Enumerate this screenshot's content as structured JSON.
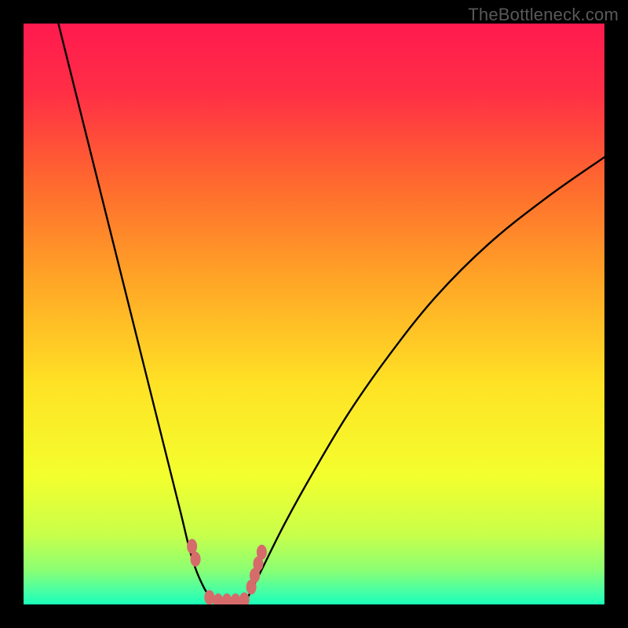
{
  "watermark": "TheBottleneck.com",
  "colors": {
    "background": "#000000",
    "watermark_text": "#595959",
    "curve": "#000000",
    "marker": "#d66b6b"
  },
  "chart_data": {
    "type": "line",
    "title": "",
    "xlabel": "",
    "ylabel": "",
    "xlim": [
      0,
      100
    ],
    "ylim": [
      0,
      100
    ],
    "grid": false,
    "legend": false,
    "background_gradient": {
      "description": "Vertical rainbow gradient: bright red at top through orange and yellow to green at bottom",
      "stops": [
        {
          "pos": 0.0,
          "color": "#ff1a4f"
        },
        {
          "pos": 0.12,
          "color": "#ff2f45"
        },
        {
          "pos": 0.28,
          "color": "#ff6b2e"
        },
        {
          "pos": 0.45,
          "color": "#ffa826"
        },
        {
          "pos": 0.62,
          "color": "#ffe225"
        },
        {
          "pos": 0.78,
          "color": "#f3ff2e"
        },
        {
          "pos": 0.88,
          "color": "#c8ff4a"
        },
        {
          "pos": 0.94,
          "color": "#8cff72"
        },
        {
          "pos": 0.98,
          "color": "#42ffa8"
        },
        {
          "pos": 1.0,
          "color": "#19ffb8"
        }
      ]
    },
    "series": [
      {
        "name": "left-branch",
        "description": "Steep V left arm descending from upper-left to valley near x≈33",
        "x": [
          6,
          9,
          12,
          15,
          18,
          21,
          24,
          27,
          29,
          31,
          33
        ],
        "y": [
          100,
          88,
          76,
          64,
          52,
          40,
          28,
          16,
          8,
          3,
          0
        ]
      },
      {
        "name": "right-branch",
        "description": "Right arm rising from valley near x≈38 with gentler curvature toward upper-right",
        "x": [
          38,
          41,
          45,
          50,
          56,
          63,
          71,
          80,
          90,
          100
        ],
        "y": [
          0,
          6,
          14,
          23,
          33,
          43,
          53,
          62,
          70,
          77
        ]
      },
      {
        "name": "valley-floor",
        "description": "Flat valley bottom between branches at y≈0",
        "x": [
          33,
          34,
          35,
          36,
          37,
          38
        ],
        "y": [
          0,
          0,
          0,
          0,
          0,
          0
        ]
      }
    ],
    "markers": {
      "name": "valley-markers",
      "description": "Salmon-colored oval markers near the valley (pairs on left descent, cluster on right ascent, and along floor)",
      "points": [
        {
          "x": 29.0,
          "y": 10.0
        },
        {
          "x": 29.6,
          "y": 7.8
        },
        {
          "x": 32.0,
          "y": 1.2
        },
        {
          "x": 33.5,
          "y": 0.6
        },
        {
          "x": 35.0,
          "y": 0.6
        },
        {
          "x": 36.5,
          "y": 0.6
        },
        {
          "x": 38.0,
          "y": 0.8
        },
        {
          "x": 39.2,
          "y": 3.0
        },
        {
          "x": 39.8,
          "y": 5.0
        },
        {
          "x": 40.4,
          "y": 7.0
        },
        {
          "x": 41.0,
          "y": 9.0
        }
      ]
    }
  }
}
